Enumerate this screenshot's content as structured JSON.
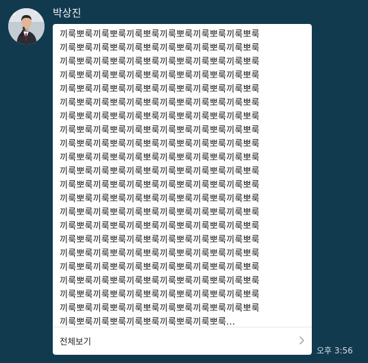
{
  "message": {
    "sender_name": "박상진",
    "lines": [
      "끼룩뽀룩끼룩뽀룩끼룩뽀룩끼룩뽀룩끼룩뽀룩끼룩뽀룩",
      "끼룩뽀룩끼룩뽀룩끼룩뽀룩끼룩뽀룩끼룩뽀룩끼룩뽀룩",
      "끼룩뽀룩끼룩뽀룩끼룩뽀룩끼룩뽀룩끼룩뽀룩끼룩뽀룩",
      "끼룩뽀룩끼룩뽀룩끼룩뽀룩끼룩뽀룩끼룩뽀룩끼룩뽀룩",
      "끼룩뽀룩끼룩뽀룩끼룩뽀룩끼룩뽀룩끼룩뽀룩끼룩뽀룩",
      "끼룩뽀룩끼룩뽀룩끼룩뽀룩끼룩뽀룩끼룩뽀룩끼룩뽀룩",
      "끼룩뽀룩끼룩뽀룩끼룩뽀룩끼룩뽀룩끼룩뽀룩끼룩뽀룩",
      "끼룩뽀룩끼룩뽀룩끼룩뽀룩끼룩뽀룩끼룩뽀룩끼룩뽀룩",
      "끼룩뽀룩끼룩뽀룩끼룩뽀룩끼룩뽀룩끼룩뽀룩끼룩뽀룩",
      "끼룩뽀룩끼룩뽀룩끼룩뽀룩끼룩뽀룩끼룩뽀룩끼룩뽀룩",
      "끼룩뽀룩끼룩뽀룩끼룩뽀룩끼룩뽀룩끼룩뽀룩끼룩뽀룩",
      "끼룩뽀룩끼룩뽀룩끼룩뽀룩끼룩뽀룩끼룩뽀룩끼룩뽀룩",
      "끼룩뽀룩끼룩뽀룩끼룩뽀룩끼룩뽀룩끼룩뽀룩끼룩뽀룩",
      "끼룩뽀룩끼룩뽀룩끼룩뽀룩끼룩뽀룩끼룩뽀룩끼룩뽀룩",
      "끼룩뽀룩끼룩뽀룩끼룩뽀룩끼룩뽀룩끼룩뽀룩끼룩뽀룩",
      "끼룩뽀룩끼룩뽀룩끼룩뽀룩끼룩뽀룩끼룩뽀룩끼룩뽀룩",
      "끼룩뽀룩끼룩뽀룩끼룩뽀룩끼룩뽀룩끼룩뽀룩끼룩뽀룩",
      "끼룩뽀룩끼룩뽀룩끼룩뽀룩끼룩뽀룩끼룩뽀룩끼룩뽀룩",
      "끼룩뽀룩끼룩뽀룩끼룩뽀룩끼룩뽀룩끼룩뽀룩끼룩뽀룩",
      "끼룩뽀룩끼룩뽀룩끼룩뽀룩끼룩뽀룩끼룩뽀룩끼룩뽀룩",
      "끼룩뽀룩끼룩뽀룩끼룩뽀룩끼룩뽀룩끼룩뽀룩끼룩뽀룩",
      "끼룩뽀룩끼룩뽀룩끼룩뽀룩끼룩뽀룩끼룩뽀룩..."
    ],
    "view_all_label": "전체보기",
    "timestamp": "오후 3:56"
  },
  "icons": {
    "avatar": "profile-photo",
    "view_all": "chevron-right-icon"
  },
  "colors": {
    "background": "#123a4f",
    "bubble": "#ffffff",
    "text": "#1b1b1b",
    "sender_name": "#f2f6f8",
    "timestamp": "#d4dde3"
  }
}
